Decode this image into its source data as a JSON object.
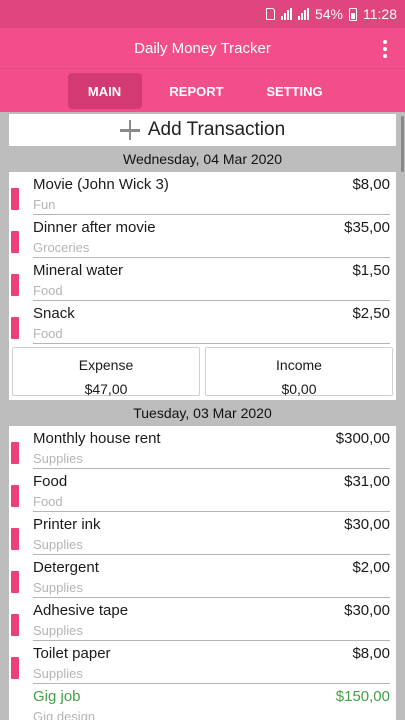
{
  "status_bar": {
    "battery": "54%",
    "time": "11:28"
  },
  "app": {
    "title": "Daily Money Tracker"
  },
  "tabs": [
    {
      "label": "MAIN"
    },
    {
      "label": "REPORT"
    },
    {
      "label": "SETTING"
    }
  ],
  "add_button": {
    "label": "Add Transaction"
  },
  "days": [
    {
      "date": "Wednesday, 04 Mar 2020",
      "transactions": [
        {
          "name": "Movie (John Wick 3)",
          "category": "Fun",
          "amount": "$8,00"
        },
        {
          "name": "Dinner after movie",
          "category": "Groceries",
          "amount": "$35,00"
        },
        {
          "name": "Mineral water",
          "category": "Food",
          "amount": "$1,50"
        },
        {
          "name": "Snack",
          "category": "Food",
          "amount": "$2,50"
        }
      ],
      "summary": {
        "expense_label": "Expense",
        "expense_value": "$47,00",
        "income_label": "Income",
        "income_value": "$0,00"
      }
    },
    {
      "date": "Tuesday, 03 Mar 2020",
      "transactions": [
        {
          "name": "Monthly house rent",
          "category": "Supplies",
          "amount": "$300,00"
        },
        {
          "name": "Food",
          "category": "Food",
          "amount": "$31,00"
        },
        {
          "name": "Printer ink",
          "category": "Supplies",
          "amount": "$30,00"
        },
        {
          "name": "Detergent",
          "category": "Supplies",
          "amount": "$2,00"
        },
        {
          "name": "Adhesive tape",
          "category": "Supplies",
          "amount": "$30,00"
        },
        {
          "name": "Toilet paper",
          "category": "Supplies",
          "amount": "$8,00"
        },
        {
          "name": "Gig job",
          "category": "Gig design",
          "amount": "$150,00"
        }
      ]
    }
  ],
  "colors": {
    "primary": "#f24f8a",
    "status_bar": "#e0467e",
    "expense_marker": "#ec407a",
    "income_text": "#43a047"
  }
}
